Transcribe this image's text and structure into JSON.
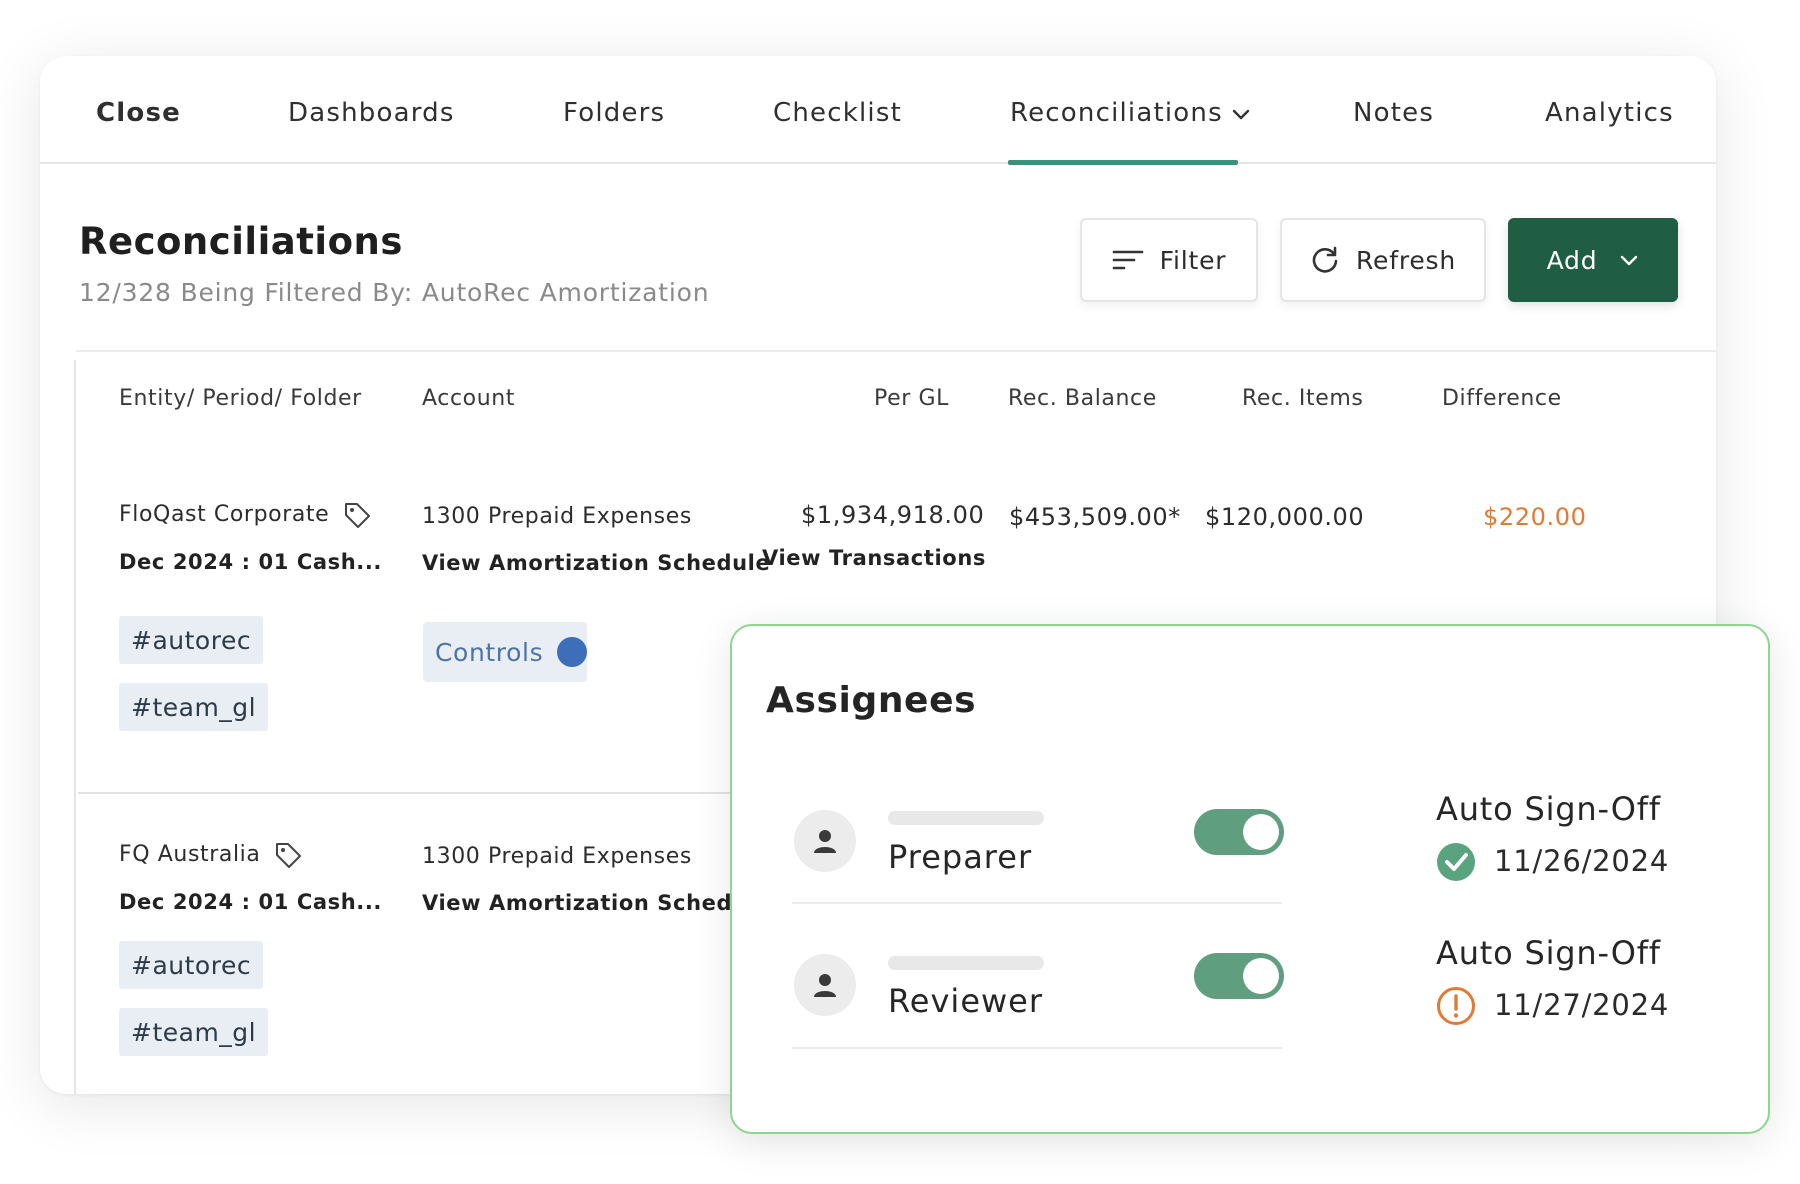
{
  "nav": {
    "tabs": [
      {
        "label": "Close"
      },
      {
        "label": "Dashboards"
      },
      {
        "label": "Folders"
      },
      {
        "label": "Checklist"
      },
      {
        "label": "Reconciliations"
      },
      {
        "label": "Notes"
      },
      {
        "label": "Analytics"
      }
    ],
    "active_tab": "Reconciliations",
    "active_color": "#3f8f7d"
  },
  "header": {
    "title": "Reconciliations",
    "subtitle": "12/328 Being Filtered By: AutoRec Amortization"
  },
  "toolbar": {
    "filter_label": "Filter",
    "refresh_label": "Refresh",
    "add_label": "Add",
    "add_color": "#1f5e44"
  },
  "table": {
    "columns": [
      "Entity/ Period/ Folder",
      "Account",
      "Per GL",
      "Rec. Balance",
      "Rec. Items",
      "Difference"
    ],
    "rows": [
      {
        "entity": "FloQast Corporate",
        "period": "Dec 2024 : 01 Cash...",
        "tags": [
          "#autorec",
          "#team_gl"
        ],
        "account": "1300 Prepaid Expenses",
        "account_link": "View Amortization Schedule",
        "controls_label": "Controls",
        "per_gl": "$1,934,918.00",
        "per_gl_link": "View Transactions",
        "rec_balance": "$453,509.00*",
        "rec_items": "$120,000.00",
        "difference": "$220.00",
        "difference_color": "#e07a34"
      },
      {
        "entity": "FQ Australia",
        "period": "Dec 2024 : 01 Cash...",
        "tags": [
          "#autorec",
          "#team_gl"
        ],
        "account": "1300 Prepaid Expenses",
        "account_link": "View Amortization Schedule"
      }
    ]
  },
  "assignees": {
    "title": "Assignees",
    "items": [
      {
        "role": "Preparer",
        "toggle_on": true,
        "signoff_label": "Auto Sign-Off",
        "signoff_date": "11/26/2024",
        "status_icon": "check-circle-icon",
        "status_color": "#5aa37f"
      },
      {
        "role": "Reviewer",
        "toggle_on": true,
        "signoff_label": "Auto Sign-Off",
        "signoff_date": "11/27/2024",
        "status_icon": "warning-circle-icon",
        "status_color": "#e07a34"
      }
    ]
  }
}
